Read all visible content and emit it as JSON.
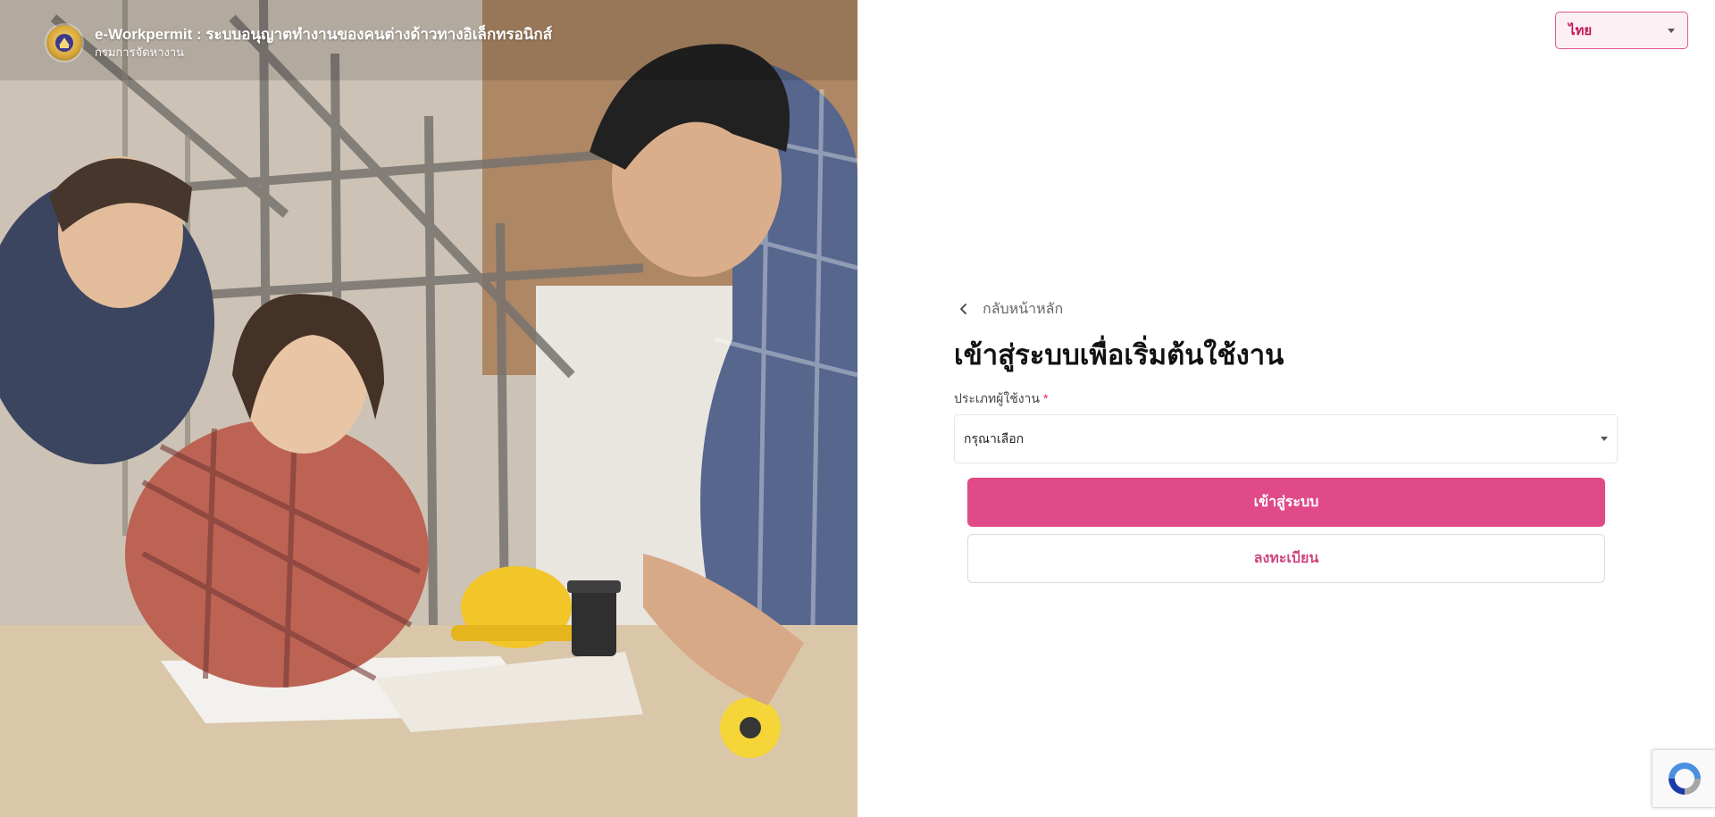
{
  "header": {
    "title": "e-Workpermit : ระบบอนุญาตทำงานของคนต่างด้าวทางอิเล็กทรอนิกส์",
    "subtitle": "กรมการจัดหางาน"
  },
  "language_select": {
    "value": "ไทย"
  },
  "login_form": {
    "back_label": "กลับหน้าหลัก",
    "title": "เข้าสู่ระบบเพื่อเริ่มต้นใช้งาน",
    "user_type_label": "ประเภทผู้ใช้งาน",
    "required_mark": "*",
    "user_type_value": "กรุณาเลือก",
    "login_button": "เข้าสู่ระบบ",
    "register_button": "ลงทะเบียน"
  },
  "colors": {
    "accent": "#e04a89",
    "accent_text": "#d0457f",
    "required": "#e0245e"
  },
  "icons": {
    "back": "chevron-left-icon",
    "select_caret": "caret-down-icon",
    "seal": "department-seal-icon",
    "recaptcha": "recaptcha-icon"
  }
}
